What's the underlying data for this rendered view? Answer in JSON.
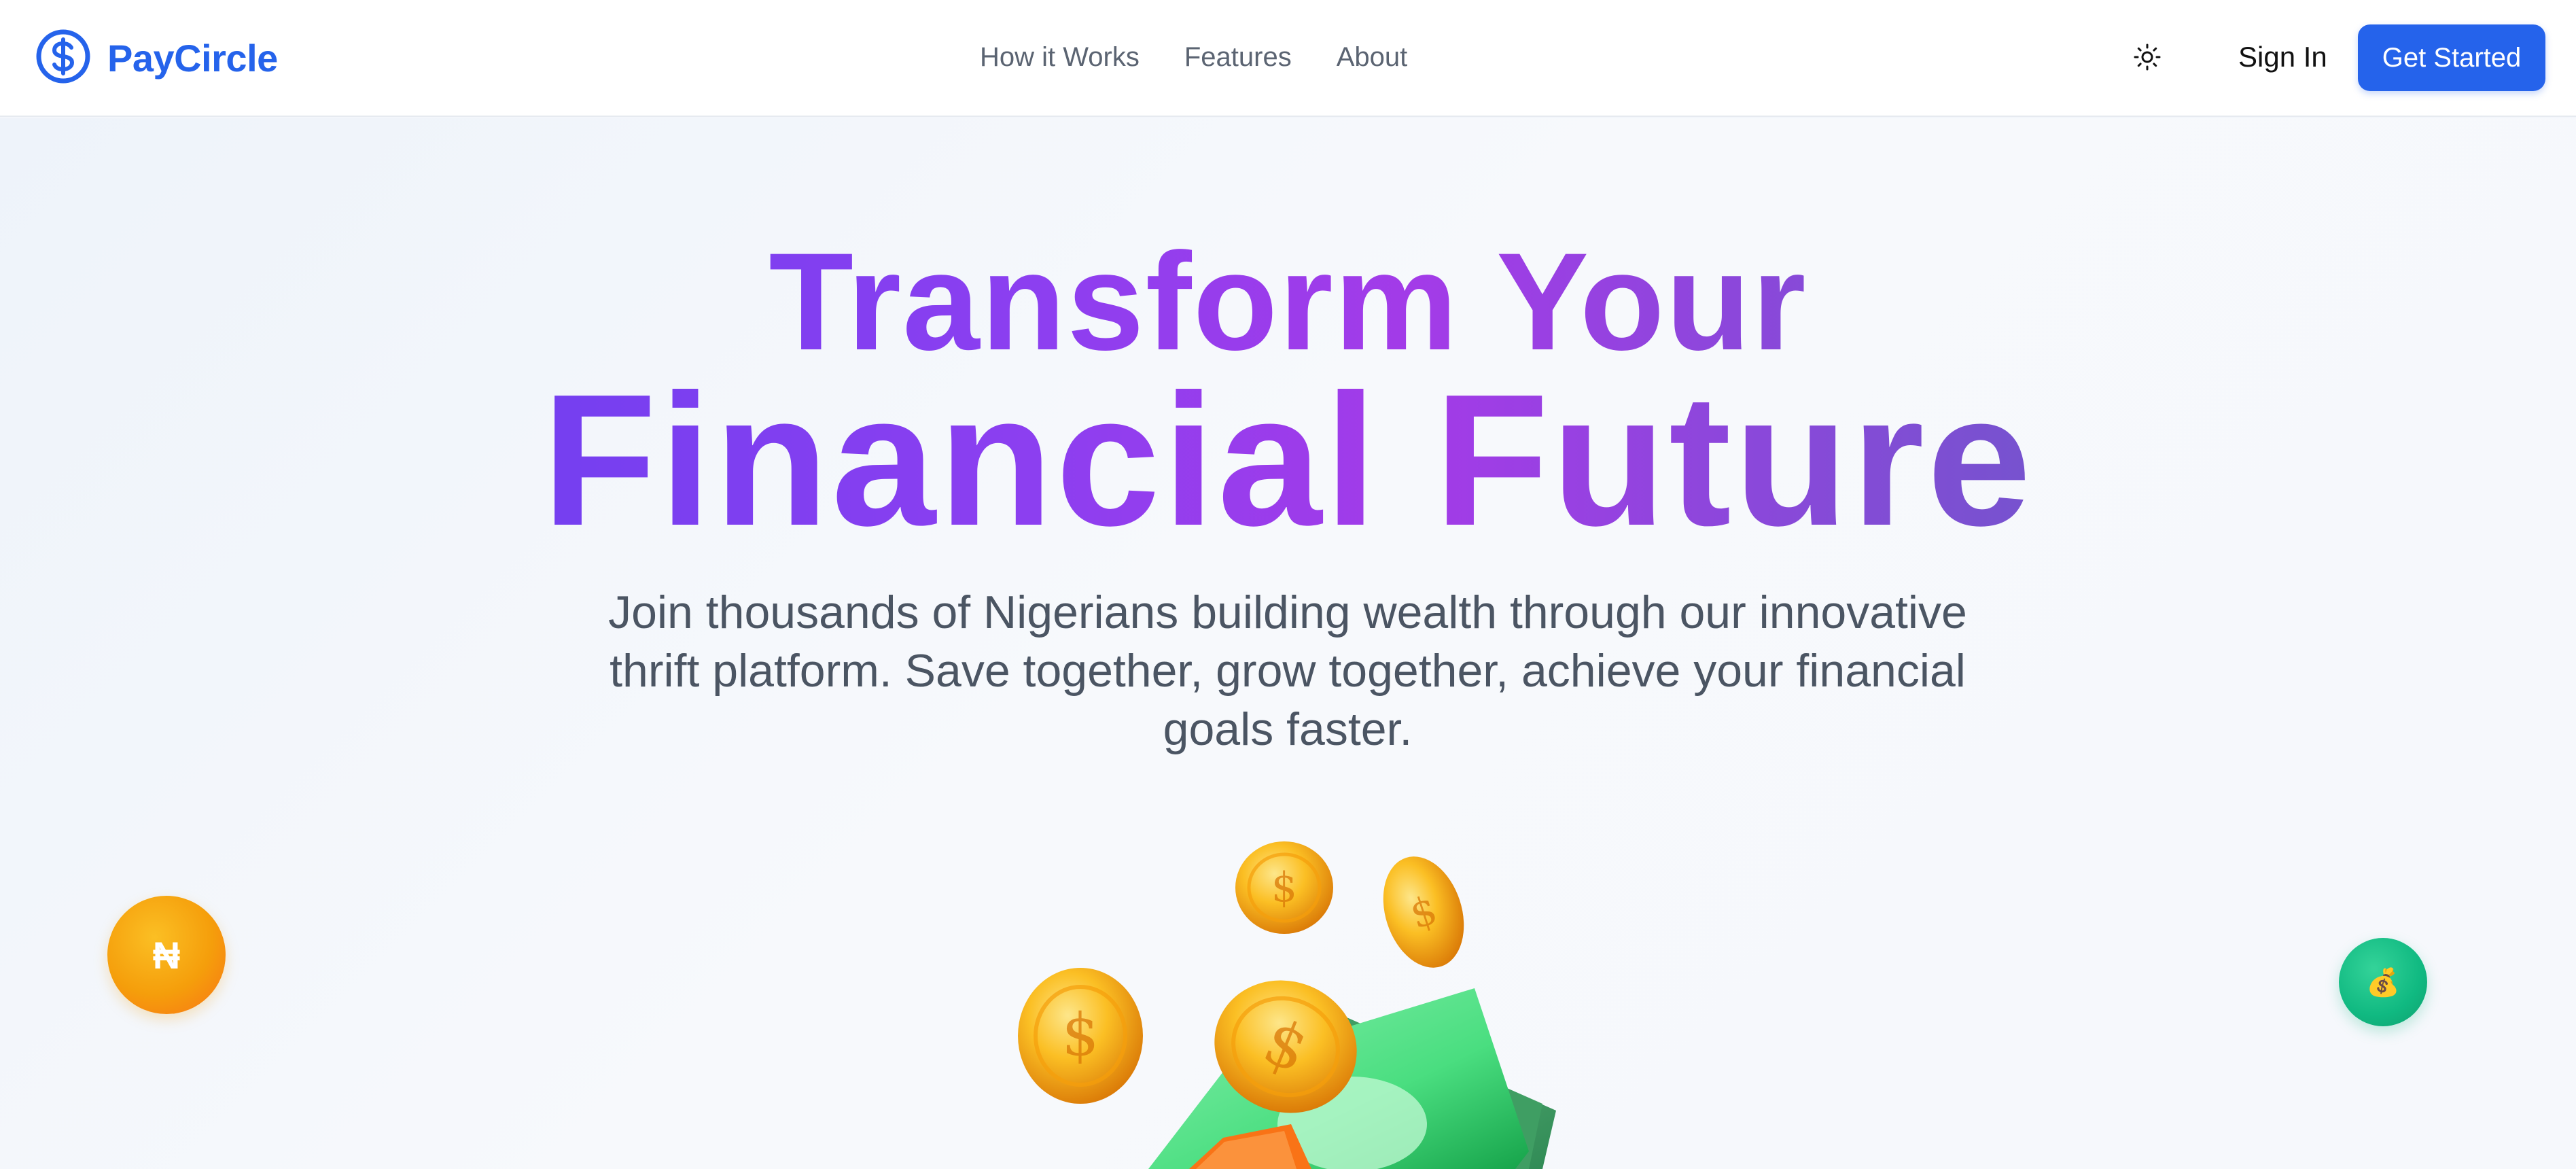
{
  "brand": {
    "name": "PayCircle",
    "icon": "dollar-circle-icon",
    "color": "#2563eb"
  },
  "nav": {
    "items": [
      {
        "label": "How it Works"
      },
      {
        "label": "Features"
      },
      {
        "label": "About"
      }
    ]
  },
  "header_actions": {
    "theme_icon": "sun-icon",
    "sign_in_label": "Sign In",
    "get_started_label": "Get Started"
  },
  "hero": {
    "title_line_1": "Transform Your",
    "title_line_2": "Financial Future",
    "subtitle": "Join thousands of Nigerians building wealth through our innovative thrift platform. Save together, grow together, achieve your financial goals faster.",
    "gradient_colors": [
      "#5b3ff0",
      "#a33be8",
      "#4f67b8"
    ],
    "naira_coin_symbol": "₦",
    "moneybag_symbol": "💰",
    "illustration": "coins-and-cash-illustration"
  }
}
